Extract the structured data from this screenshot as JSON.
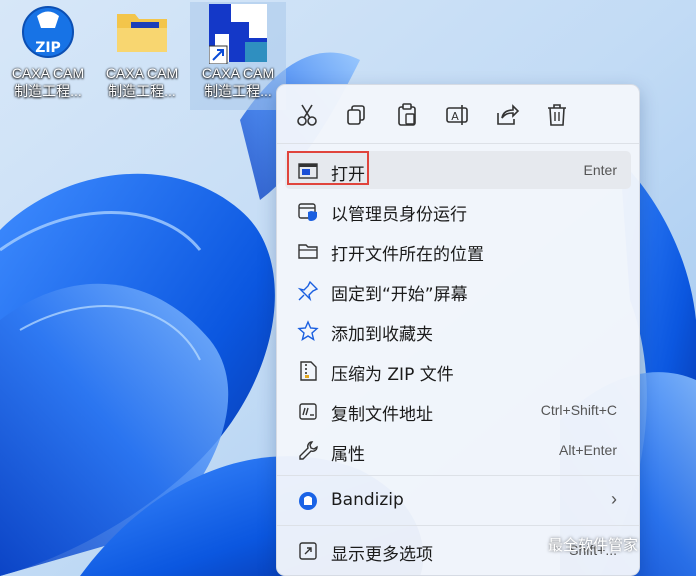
{
  "desktop": {
    "icons": [
      {
        "line1": "CAXA CAM",
        "line2": "制造工程..."
      },
      {
        "line1": "CAXA CAM",
        "line2": "制造工程..."
      },
      {
        "line1": "CAXA CAM",
        "line2": "制造工程..."
      }
    ]
  },
  "context_menu": {
    "toolbar": [
      "cut-icon",
      "copy-icon",
      "paste-icon",
      "rename-icon",
      "share-icon",
      "delete-icon"
    ],
    "items": [
      {
        "label": "打开",
        "shortcut": "Enter"
      },
      {
        "label": "以管理员身份运行",
        "shortcut": ""
      },
      {
        "label": "打开文件所在的位置",
        "shortcut": ""
      },
      {
        "label": "固定到“开始”屏幕",
        "shortcut": ""
      },
      {
        "label": "添加到收藏夹",
        "shortcut": ""
      },
      {
        "label": "压缩为 ZIP 文件",
        "shortcut": ""
      },
      {
        "label": "复制文件地址",
        "shortcut": "Ctrl+Shift+C"
      },
      {
        "label": "属性",
        "shortcut": "Alt+Enter"
      },
      {
        "label": "Bandizip",
        "shortcut": ""
      },
      {
        "label": "显示更多选项",
        "shortcut": "Shift+..."
      }
    ]
  },
  "watermark": "最全软件管家",
  "colors": {
    "accent": "#0a5bd8",
    "highlight_border": "#e0443c"
  }
}
